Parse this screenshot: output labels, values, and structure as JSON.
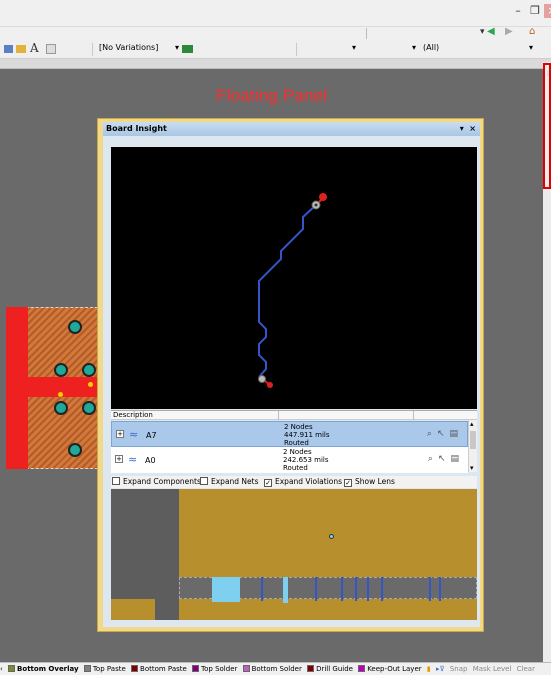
{
  "toolbar": {
    "variations": "[No Variations]",
    "filter_all": "(All)"
  },
  "canvas": {
    "floating_label": "Floating Panel"
  },
  "panel": {
    "title": "Board Insight",
    "pin_icon": "▾",
    "close_icon": "×",
    "column_description": "Description",
    "nets": [
      {
        "name": "A7",
        "nodes": "2 Nodes",
        "length": "447.911 mils",
        "status": "Routed",
        "selected": true
      },
      {
        "name": "A0",
        "nodes": "2 Nodes",
        "length": "242.653 mils",
        "status": "Routed",
        "selected": false
      }
    ],
    "options": [
      {
        "label": "Expand Components",
        "checked": false
      },
      {
        "label": "Expand Nets",
        "checked": false
      },
      {
        "label": "Expand Violations",
        "checked": true
      },
      {
        "label": "Show Lens",
        "checked": true
      }
    ]
  },
  "statusbar": {
    "layers": [
      {
        "label": "Bottom Overlay",
        "color": "#7d8b2e",
        "active": true
      },
      {
        "label": "Top Paste",
        "color": "#808080",
        "active": false
      },
      {
        "label": "Bottom Paste",
        "color": "#800000",
        "active": false
      },
      {
        "label": "Top Solder",
        "color": "#800080",
        "active": false
      },
      {
        "label": "Bottom Solder",
        "color": "#c060c0",
        "active": false
      },
      {
        "label": "Drill Guide",
        "color": "#800000",
        "active": false
      },
      {
        "label": "Keep-Out Layer",
        "color": "#c000c0",
        "active": false
      }
    ],
    "snap": "Snap",
    "mask_level": "Mask Level",
    "clear": "Clear"
  },
  "colors": {
    "float_label": "#ff2a2a",
    "panel_frame": "#f2d98a",
    "trace": "#3556c8",
    "pad": "#1fa99b"
  }
}
